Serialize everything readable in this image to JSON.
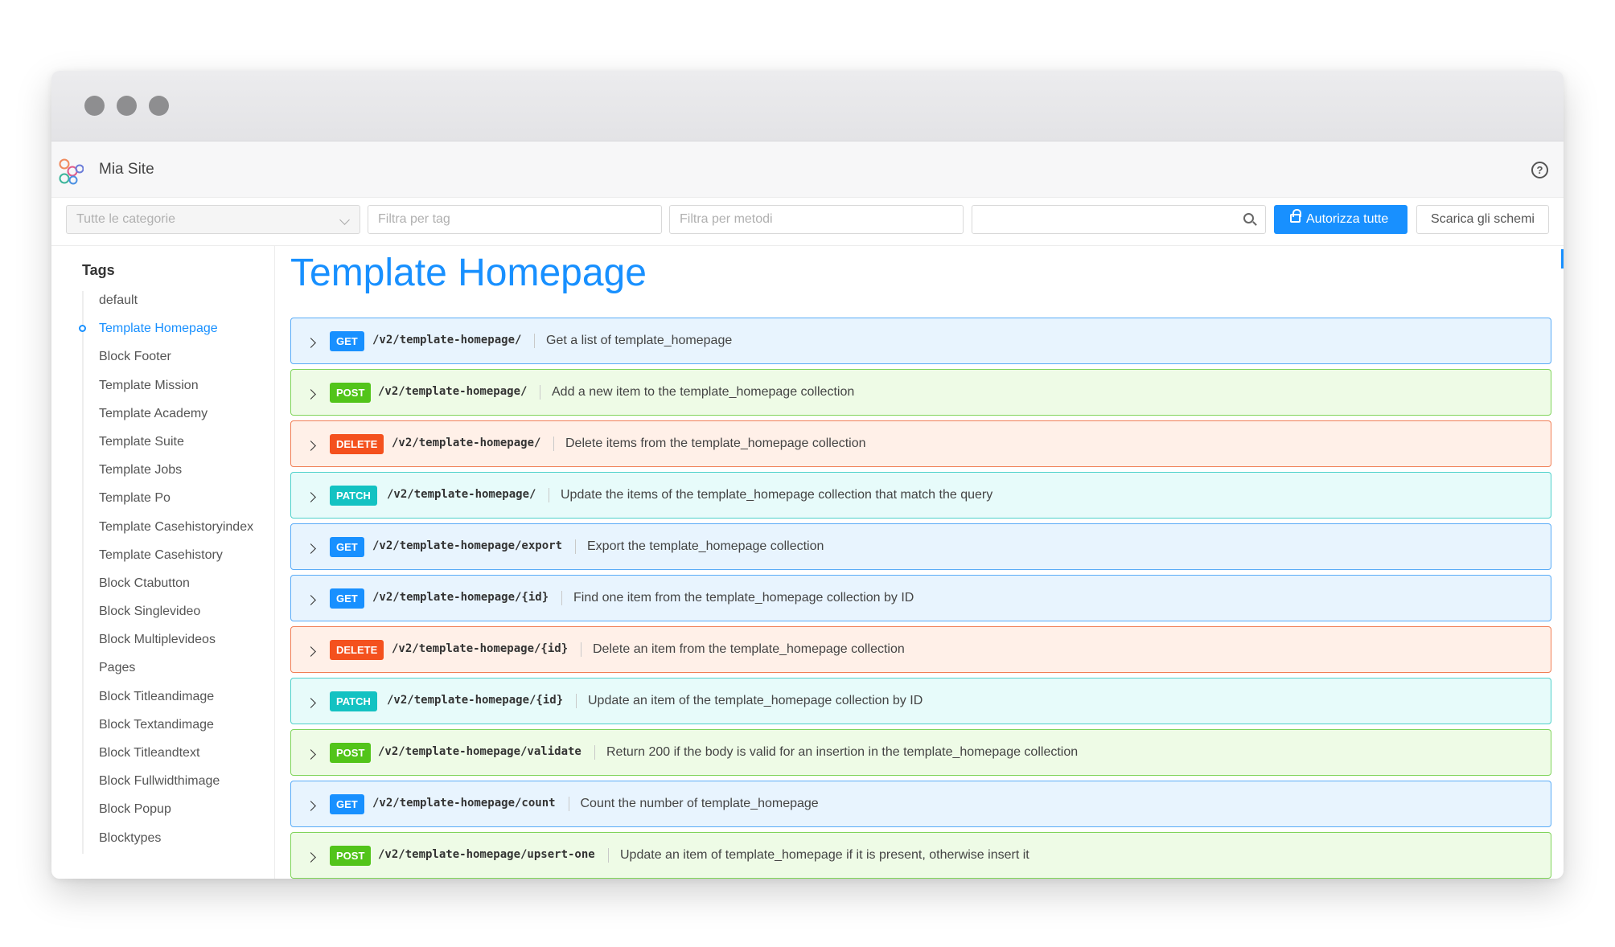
{
  "app": {
    "site_name": "Mia Site"
  },
  "filters": {
    "category_placeholder": "Tutte le categorie",
    "tag_placeholder": "Filtra per tag",
    "method_placeholder": "Filtra per metodi",
    "search_placeholder": ""
  },
  "buttons": {
    "authorize": "Autorizza tutte",
    "download": "Scarica gli schemi"
  },
  "sidebar": {
    "heading": "Tags",
    "items": [
      "default",
      "Template Homepage",
      "Block Footer",
      "Template Mission",
      "Template Academy",
      "Template Suite",
      "Template Jobs",
      "Template Po",
      "Template Casehistoryindex",
      "Template Casehistory",
      "Block Ctabutton",
      "Block Singlevideo",
      "Block Multiplevideos",
      "Pages",
      "Block Titleandimage",
      "Block Textandimage",
      "Block Titleandtext",
      "Block Fullwidthimage",
      "Block Popup",
      "Blocktypes"
    ],
    "active": "Template Homepage"
  },
  "main": {
    "title": "Template Homepage",
    "operations": [
      {
        "method": "GET",
        "path": "/v2/template-homepage/",
        "desc": "Get a list of template_homepage"
      },
      {
        "method": "POST",
        "path": "/v2/template-homepage/",
        "desc": "Add a new item to the template_homepage collection"
      },
      {
        "method": "DELETE",
        "path": "/v2/template-homepage/",
        "desc": "Delete items from the template_homepage collection"
      },
      {
        "method": "PATCH",
        "path": "/v2/template-homepage/",
        "desc": "Update the items of the template_homepage collection that match the query"
      },
      {
        "method": "GET",
        "path": "/v2/template-homepage/export",
        "desc": "Export the template_homepage collection"
      },
      {
        "method": "GET",
        "path": "/v2/template-homepage/{id}",
        "desc": "Find one item from the template_homepage collection by ID"
      },
      {
        "method": "DELETE",
        "path": "/v2/template-homepage/{id}",
        "desc": "Delete an item from the template_homepage collection"
      },
      {
        "method": "PATCH",
        "path": "/v2/template-homepage/{id}",
        "desc": "Update an item of the template_homepage collection by ID"
      },
      {
        "method": "POST",
        "path": "/v2/template-homepage/validate",
        "desc": "Return 200 if the body is valid for an insertion in the template_homepage collection"
      },
      {
        "method": "GET",
        "path": "/v2/template-homepage/count",
        "desc": "Count the number of template_homepage"
      },
      {
        "method": "POST",
        "path": "/v2/template-homepage/upsert-one",
        "desc": "Update an item of template_homepage if it is present, otherwise insert it"
      }
    ]
  },
  "colors": {
    "accent": "#1890ff",
    "get": "#1890ff",
    "post": "#52c41a",
    "delete": "#f4511e",
    "patch": "#13c2c2"
  },
  "icons": {
    "logo": "hexagon-cluster-logo",
    "help": "question-circle-icon",
    "search": "search-icon",
    "lock": "lock-icon",
    "expand": "chevron-right-icon",
    "select": "chevron-down-icon"
  }
}
